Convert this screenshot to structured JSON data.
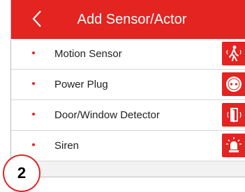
{
  "header": {
    "title": "Add Sensor/Actor",
    "back_icon": "chevron-left-icon"
  },
  "items": [
    {
      "label": "Motion Sensor",
      "icon": "motion-sensor-icon"
    },
    {
      "label": "Power Plug",
      "icon": "power-plug-icon"
    },
    {
      "label": "Door/Window Detector",
      "icon": "door-window-detector-icon"
    },
    {
      "label": "Siren",
      "icon": "siren-icon"
    }
  ],
  "step": {
    "number": "2"
  },
  "colors": {
    "accent": "#e32421",
    "background": "#f2f2f2",
    "row_background": "#ffffff"
  }
}
